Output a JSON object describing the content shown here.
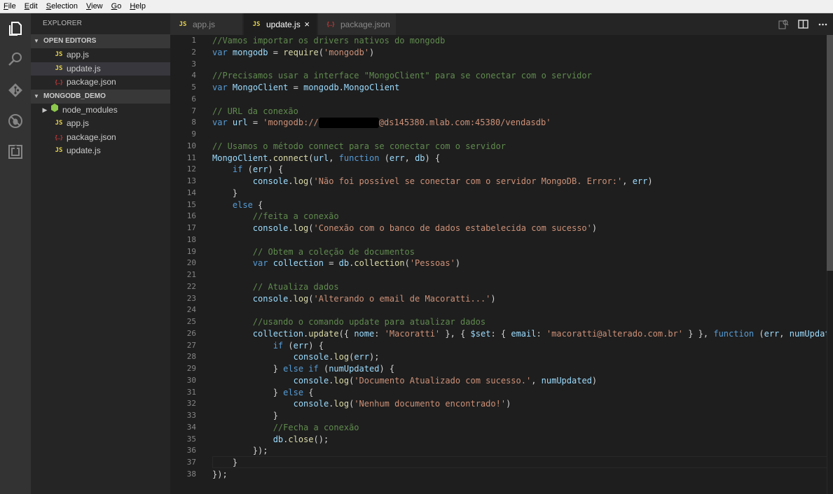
{
  "menu": [
    "File",
    "Edit",
    "Selection",
    "View",
    "Go",
    "Help"
  ],
  "activity_bar": [
    {
      "icon": "explorer-icon",
      "active": true
    },
    {
      "icon": "search-icon",
      "active": false
    },
    {
      "icon": "source-control-icon",
      "active": false
    },
    {
      "icon": "debug-icon",
      "active": false
    },
    {
      "icon": "extensions-icon",
      "active": false
    }
  ],
  "sidebar": {
    "title": "EXPLORER",
    "open_editors": {
      "label": "OPEN EDITORS",
      "items": [
        {
          "name": "app.js",
          "type": "js"
        },
        {
          "name": "update.js",
          "type": "js",
          "active": true
        },
        {
          "name": "package.json",
          "type": "json"
        }
      ]
    },
    "project": {
      "label": "MONGODB_DEMO",
      "items": [
        {
          "name": "node_modules",
          "type": "folder"
        },
        {
          "name": "app.js",
          "type": "js"
        },
        {
          "name": "package.json",
          "type": "json"
        },
        {
          "name": "update.js",
          "type": "js"
        }
      ]
    }
  },
  "tabs": [
    {
      "label": "app.js",
      "type": "js",
      "active": false
    },
    {
      "label": "update.js",
      "type": "js",
      "active": true,
      "close": "×"
    },
    {
      "label": "package.json",
      "type": "json",
      "active": false
    }
  ],
  "icons": {
    "js": "JS",
    "json": "{..}",
    "chevron_down": "▼",
    "chevron_right": "▶"
  },
  "editor": {
    "current_line": 37,
    "lines": [
      "//Vamos importar os drivers nativos do mongodb",
      "var mongodb = require('mongodb')",
      "",
      "//Precisamos usar a interface \"MongoClient\" para se conectar com o servidor",
      "var MongoClient = mongodb.MongoClient",
      "",
      "// URL da conexão",
      "var url = 'mongodb://[redacted]@ds145380.mlab.com:45380/vendasdb'",
      "",
      "// Usamos o método connect para se conectar com o servidor",
      "MongoClient.connect(url, function (err, db) {",
      "    if (err) {",
      "        console.log('Não foi possível se conectar com o servidor MongoDB. Error:', err)",
      "    }",
      "    else {",
      "        //feita a conexão",
      "        console.log('Conexão com o banco de dados estabelecida com sucesso')",
      "",
      "        // Obtem a coleção de documentos",
      "        var collection = db.collection('Pessoas')",
      "",
      "        // Atualiza dados",
      "        console.log('Alterando o email de Macoratti...')",
      "",
      "        //usando o comando update para atualizar dados",
      "        collection.update({ nome: 'Macoratti' }, { $set: { email: 'macoratti@alterado.com.br' } }, function (err, numUpdated) {",
      "            if (err) {",
      "                console.log(err);",
      "            } else if (numUpdated) {",
      "                console.log('Documento Atualizado com sucesso.', numUpdated)",
      "            } else {",
      "                console.log('Nenhum documento encontrado!')",
      "            }",
      "            //Fecha a conexão",
      "            db.close();",
      "        });",
      "    }",
      "});"
    ]
  }
}
